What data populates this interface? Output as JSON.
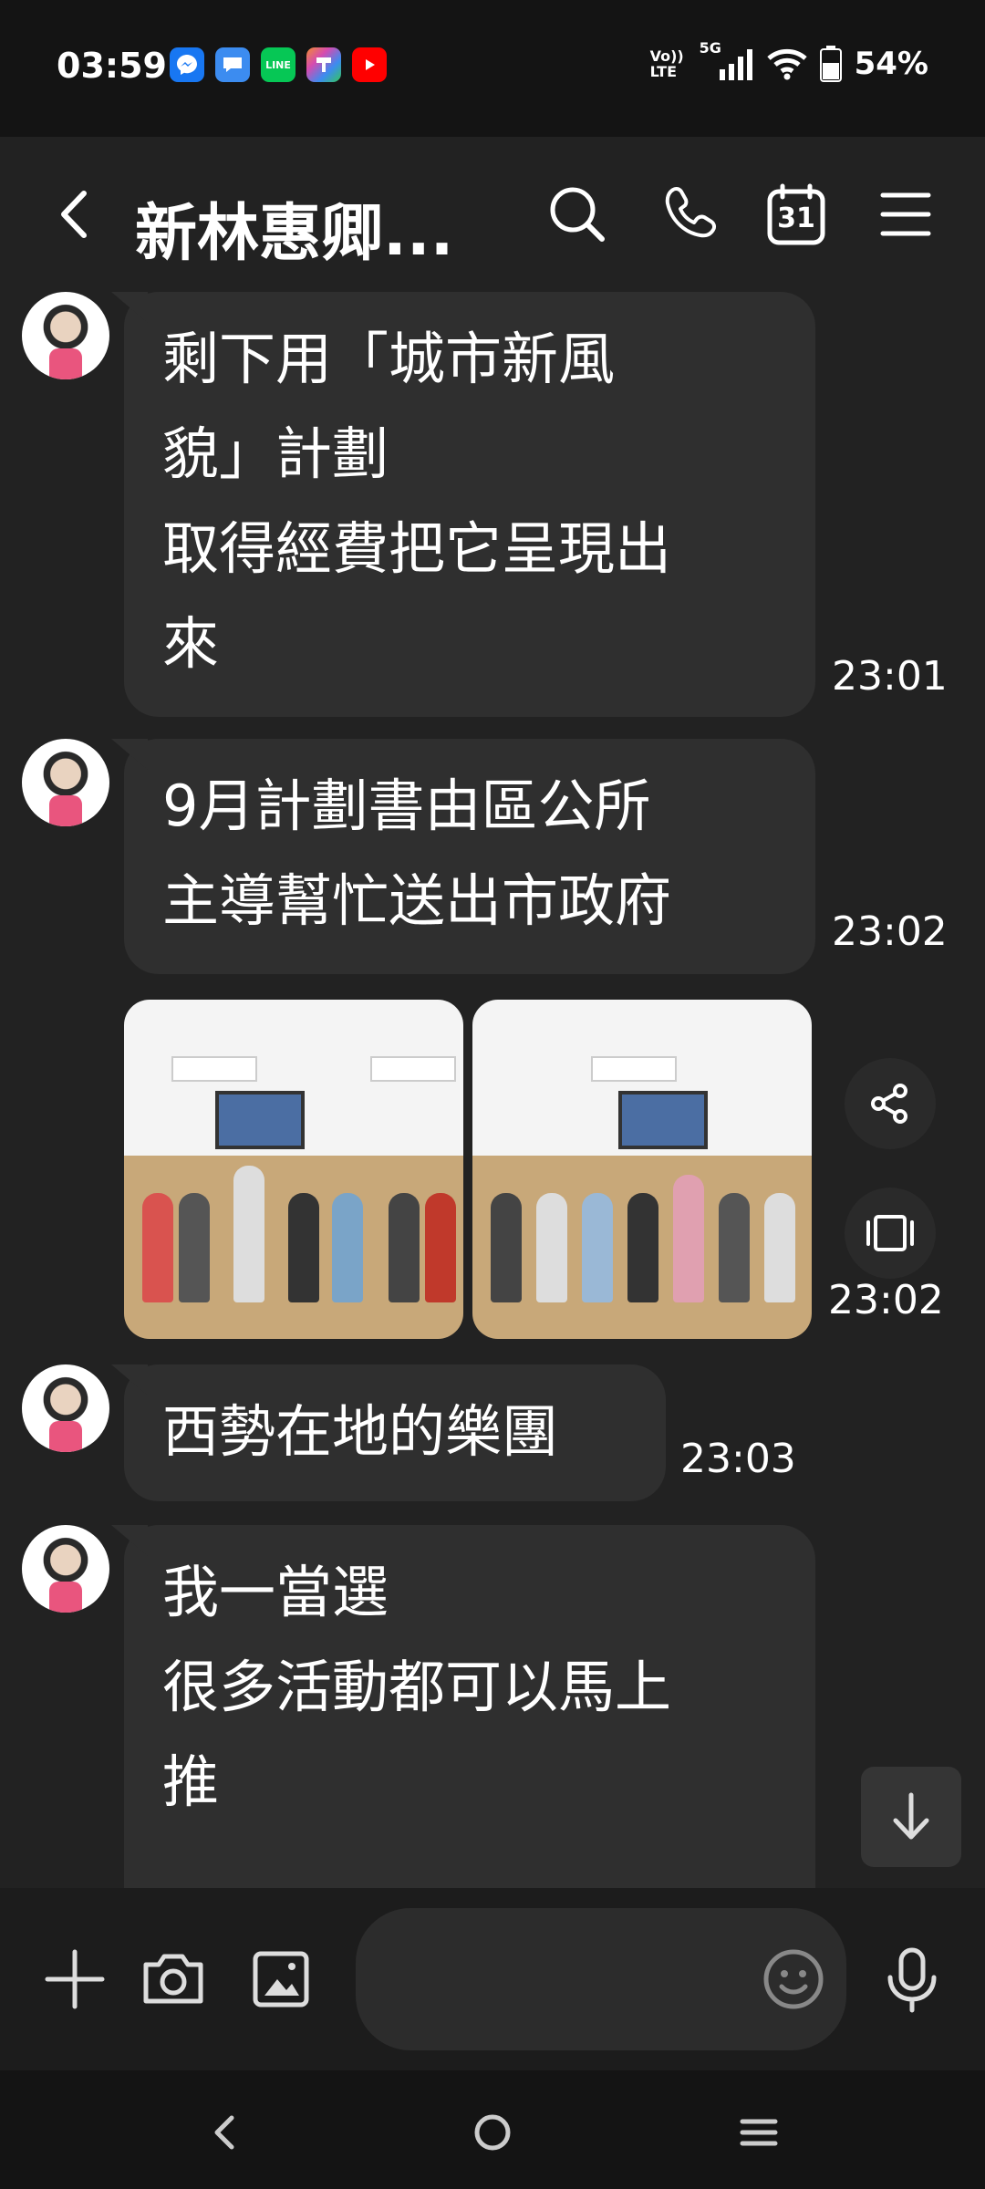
{
  "status_bar": {
    "time": "03:59",
    "notifications": [
      {
        "icon": "messenger-icon",
        "color": "#1877f2"
      },
      {
        "icon": "chat-icon",
        "color": "#3c8cf0"
      },
      {
        "icon": "line-icon",
        "color": "#06c755",
        "text": "LINE"
      },
      {
        "icon": "colorful-app-icon",
        "color": "#f28b30"
      },
      {
        "icon": "youtube-icon",
        "color": "#ff0000"
      }
    ],
    "volte": "Vo)) LTE",
    "network": "5G",
    "battery": "54%"
  },
  "header": {
    "title": "新林惠卿...",
    "calendar_day": "31"
  },
  "messages": [
    {
      "lines": [
        "剩下用「城市新風",
        "貌」計劃",
        "取得經費把它呈現出",
        "來"
      ],
      "time": "23:01"
    },
    {
      "lines": [
        "9月計劃書由區公所",
        "主導幫忙送出市政府"
      ],
      "time": "23:02"
    },
    {
      "photos": 2,
      "time": "23:02"
    },
    {
      "lines": [
        "西勢在地的樂團"
      ],
      "time": "23:03"
    },
    {
      "lines": [
        "我一當選",
        "很多活動都可以馬上",
        "推"
      ],
      "time": ""
    }
  ],
  "colors": {
    "background": "#222222",
    "bubble": "#2f2f2f",
    "bars": "#141414"
  }
}
